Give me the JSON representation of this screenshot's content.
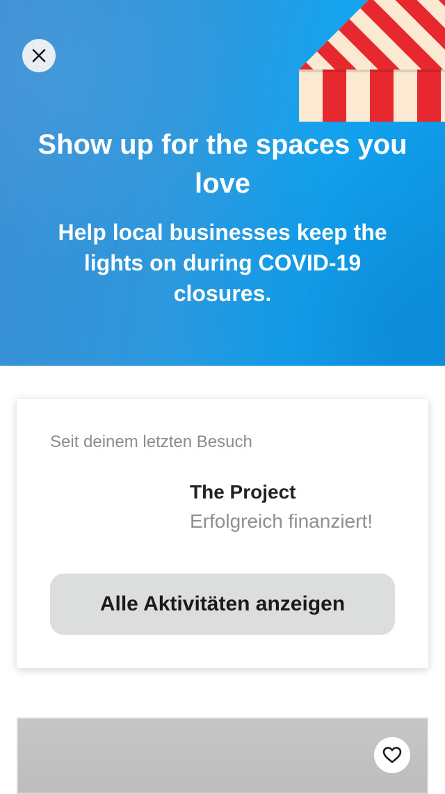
{
  "hero": {
    "title": "Show up for the spaces you love",
    "subtitle": "Help local businesses keep the lights on during COVID-19 closures.",
    "close_icon": "close-icon",
    "illustration": "striped-awning"
  },
  "activity_card": {
    "caption": "Seit deinem letzten Besuch",
    "project_name": "The Project",
    "project_status": "Erfolgreich finanziert!",
    "button_label": "Alle Aktivitäten anzeigen"
  },
  "listing": {
    "favorite_icon": "heart-icon"
  },
  "colors": {
    "hero_blue": "#2f97dc",
    "hero_blue_light": "#13a4f0",
    "button_gray": "#dcdddd",
    "caption_gray": "#8c8c8c",
    "awning_red": "#e8282f",
    "awning_cream": "#fbe9d2"
  }
}
